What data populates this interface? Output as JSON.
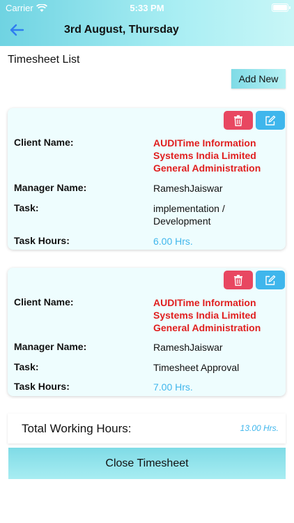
{
  "status_bar": {
    "carrier": "Carrier",
    "time": "5:33 PM"
  },
  "header": {
    "title": "3rd August, Thursday",
    "back_icon": "arrow-left-icon"
  },
  "page": {
    "list_title": "Timesheet List",
    "add_new_label": "Add New"
  },
  "labels": {
    "client": "Client Name:",
    "manager": "Manager Name:",
    "task": "Task:",
    "hours": "Task Hours:"
  },
  "entries": [
    {
      "client_name": "AUDITime Information Systems India Limited General Administration",
      "manager_name": "RameshJaiswar",
      "task": "implementation / Development",
      "task_hours": "6.00 Hrs."
    },
    {
      "client_name": "AUDITime Information Systems India Limited General Administration",
      "manager_name": "RameshJaiswar",
      "task": "Timesheet Approval",
      "task_hours": "7.00 Hrs."
    }
  ],
  "total": {
    "label": "Total Working Hours:",
    "value": "13.00 Hrs."
  },
  "footer": {
    "close_label": "Close Timesheet"
  },
  "colors": {
    "header_accent": "#6fd3e2",
    "delete": "#e84761",
    "edit": "#3fb6ec",
    "client_text": "#e01f1f",
    "hours_text": "#3fb6ec"
  }
}
